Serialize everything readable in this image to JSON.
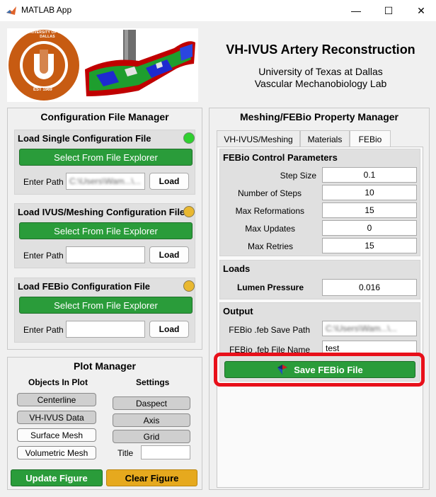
{
  "window": {
    "title": "MATLAB App",
    "minimize": "—",
    "maximize": "☐",
    "close": "✕"
  },
  "header": {
    "logo_ring_text": "THE UNIVERSITY OF TEXAS AT DALLAS",
    "logo_letters": "UTD",
    "logo_est": "EST 1969",
    "title": "VH-IVUS Artery Reconstruction",
    "subtitle_line1": "University of Texas at Dallas",
    "subtitle_line2": "Vascular Mechanobiology Lab"
  },
  "config": {
    "title": "Configuration File Manager",
    "sections": [
      {
        "title": "Load Single Configuration File",
        "lamp_color": "#2fd02f",
        "select_label": "Select From File Explorer",
        "path_label": "Enter Path",
        "path_value": "C:\\Users\\Wam...\\...",
        "load_label": "Load"
      },
      {
        "title": "Load IVUS/Meshing Configuration File",
        "lamp_color": "#e9b830",
        "select_label": "Select From File Explorer",
        "path_label": "Enter Path",
        "path_value": "",
        "load_label": "Load"
      },
      {
        "title": "Load FEBio Configuration File",
        "lamp_color": "#e9b830",
        "select_label": "Select From File Explorer",
        "path_label": "Enter Path",
        "path_value": "",
        "load_label": "Load"
      }
    ]
  },
  "plot": {
    "title": "Plot Manager",
    "objects_header": "Objects In Plot",
    "settings_header": "Settings",
    "objects": [
      {
        "label": "Centerline",
        "state": "on"
      },
      {
        "label": "VH-IVUS Data",
        "state": "on"
      },
      {
        "label": "Surface Mesh",
        "state": "off"
      },
      {
        "label": "Volumetric Mesh",
        "state": "off"
      }
    ],
    "settings": [
      {
        "label": "Daspect"
      },
      {
        "label": "Axis"
      },
      {
        "label": "Grid"
      }
    ],
    "title_label": "Title",
    "title_value": "",
    "update_label": "Update Figure",
    "clear_label": "Clear Figure"
  },
  "meshing": {
    "title": "Meshing/FEBio Property Manager",
    "tabs": [
      "VH-IVUS/Meshing",
      "Materials",
      "FEBio"
    ],
    "control": {
      "title": "FEBio Control Parameters",
      "fields": [
        {
          "label": "Step Size",
          "value": "0.1"
        },
        {
          "label": "Number of Steps",
          "value": "10"
        },
        {
          "label": "Max Reformations",
          "value": "15"
        },
        {
          "label": "Max Updates",
          "value": "0"
        },
        {
          "label": "Max Retries",
          "value": "15"
        }
      ]
    },
    "loads": {
      "title": "Loads",
      "pressure_label": "Lumen Pressure",
      "pressure_value": "0.016"
    },
    "output": {
      "title": "Output",
      "save_path_label": "FEBio .feb Save Path",
      "save_path_value": "C:\\Users\\Wam...\\...",
      "file_name_label": "FEBio .feb File Name",
      "file_name_value": "test",
      "save_button": "Save FEBio File"
    }
  }
}
